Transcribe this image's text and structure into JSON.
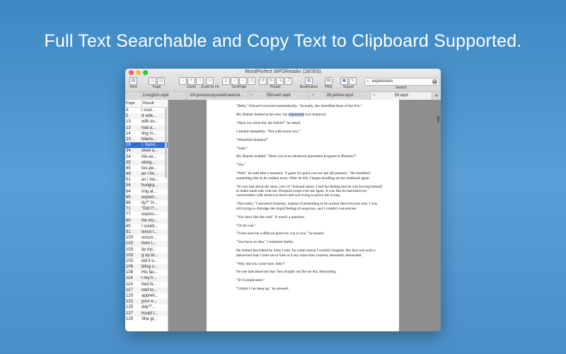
{
  "headline": "Full Text Searchable and Copy Text to Clipboard Supported.",
  "window": {
    "title": "WordPerfect WPDReader (28/353)"
  },
  "toolbar": {
    "view": "View",
    "page": "Page",
    "zoom": "Zoom",
    "zoom_to_fit": "Zoom to Fit",
    "turn_page": "TurnPage",
    "rotate": "Rotate",
    "bookmarks": "Bookmarks",
    "print": "Print",
    "export": "Export",
    "search_label": "Search",
    "search_value": "expression"
  },
  "tabs": [
    {
      "label": "2.english.wpd"
    },
    {
      "label": "24.previouslyusedmaterial..."
    },
    {
      "label": "35insert.wpd"
    },
    {
      "label": "26.petrev.wpd"
    },
    {
      "label": "38.wpd"
    }
  ],
  "results_header": {
    "page": "Page",
    "result": "Result"
  },
  "results": [
    {
      "page": "4",
      "result": "I coul..."
    },
    {
      "page": "5",
      "result": "d side..."
    },
    {
      "page": "13",
      "result": "with ev..."
    },
    {
      "page": "13",
      "result": "had a..."
    },
    {
      "page": "14",
      "result": "ting m..."
    },
    {
      "page": "23",
      "result": "hilario..."
    },
    {
      "page": "28",
      "result": "r. Bann..."
    },
    {
      "page": "34",
      "result": "oked a..."
    },
    {
      "page": "34",
      "result": "His ex..."
    },
    {
      "page": "35",
      "result": "oking..."
    },
    {
      "page": "45",
      "result": "too-pe..."
    },
    {
      "page": "49",
      "result": "en I fin..."
    },
    {
      "page": "51",
      "result": "as I loo..."
    },
    {
      "page": "56",
      "result": "hungry..."
    },
    {
      "page": "64",
      "result": "ring at..."
    },
    {
      "page": "65",
      "result": "expres..."
    },
    {
      "page": "66",
      "result": "tly?\" H..."
    },
    {
      "page": "71",
      "result": "\"Did I?..."
    },
    {
      "page": "77",
      "result": "expres..."
    },
    {
      "page": "80",
      "result": "He mu..."
    },
    {
      "page": "80",
      "result": "I could..."
    },
    {
      "page": "91",
      "result": "lence t..."
    },
    {
      "page": "100",
      "result": "occurr..."
    },
    {
      "page": "102",
      "result": "from t..."
    },
    {
      "page": "103",
      "result": "lip tryi..."
    },
    {
      "page": "103",
      "result": "g up to..."
    },
    {
      "page": "103",
      "result": "eld it o..."
    },
    {
      "page": "106",
      "result": "bling o..."
    },
    {
      "page": "109",
      "result": "His fac..."
    },
    {
      "page": "114",
      "result": "t my h..."
    },
    {
      "page": "114",
      "result": "hed hi..."
    },
    {
      "page": "117",
      "result": "ned to..."
    },
    {
      "page": "120",
      "result": "appreh..."
    },
    {
      "page": "121",
      "result": "your e..."
    },
    {
      "page": "125",
      "result": "day?\"..."
    },
    {
      "page": "127",
      "result": "hould I..."
    },
    {
      "page": "129",
      "result": "She gl..."
    }
  ],
  "selected_index": 6,
  "document": {
    "p1": "\"Bella,\" Edward corrected automatically. \"Actually, she identified three of the five.\"",
    "p2_before": "Mr. Banner looked at me now; his ",
    "p2_highlight": "expression",
    "p2_after": " was skeptical.",
    "p3": "\"Have you done this lab before?\" he asked.",
    "p4": "I smiled sheepishly. \"Not with onion root.\"",
    "p5": "\"Whitefish blastula?\"",
    "p6": "\"Yeah.\"",
    "p7": "Mr. Banner nodded. \"Were you in an advanced placement program in Phoenix?\"",
    "p8": "\"Yes.\"",
    "p9": "\"Well,\" he said after a moment, \"I guess it's good you two are lab partners.\" He mumbled something else as he walked away. After he left, I began doodling on my notebook again.",
    "p10": "\"It's too bad about the snow, isn't it?\" Edward asked. I had the feeling that he was forcing himself to make small talk with me. Paranoia swept over me again. It was like he had heard my conversation with Jessica at lunch and was trying to prove me wrong.",
    "p11": "\"Not really,\" I answered honestly, instead of pretending to be normal like everyone else. I was still trying to dislodge the stupid feeling of suspicion, and I couldn't concentrate.",
    "p12": "\"You don't like the cold.\" It wasn't a question.",
    "p13": "\"Or the wet.\"",
    "p14": "\"Forks must be a difficult place for you to live,\" he mused.",
    "p15": "\"You have no idea,\" I muttered darkly.",
    "p16": "He looked fascinated by what I said, for some reason I couldn't imagine. His face was such a distraction that I tried not to look at it any more than courtesy absolutely demanded.",
    "p17": "\"Why did you come here, then?\"",
    "p18": "No one had asked me that ?not straight out like he did, demanding.",
    "p19": "\"It's?complicated.\"",
    "p20": "\"I think I can keep up,\" he pressed."
  }
}
